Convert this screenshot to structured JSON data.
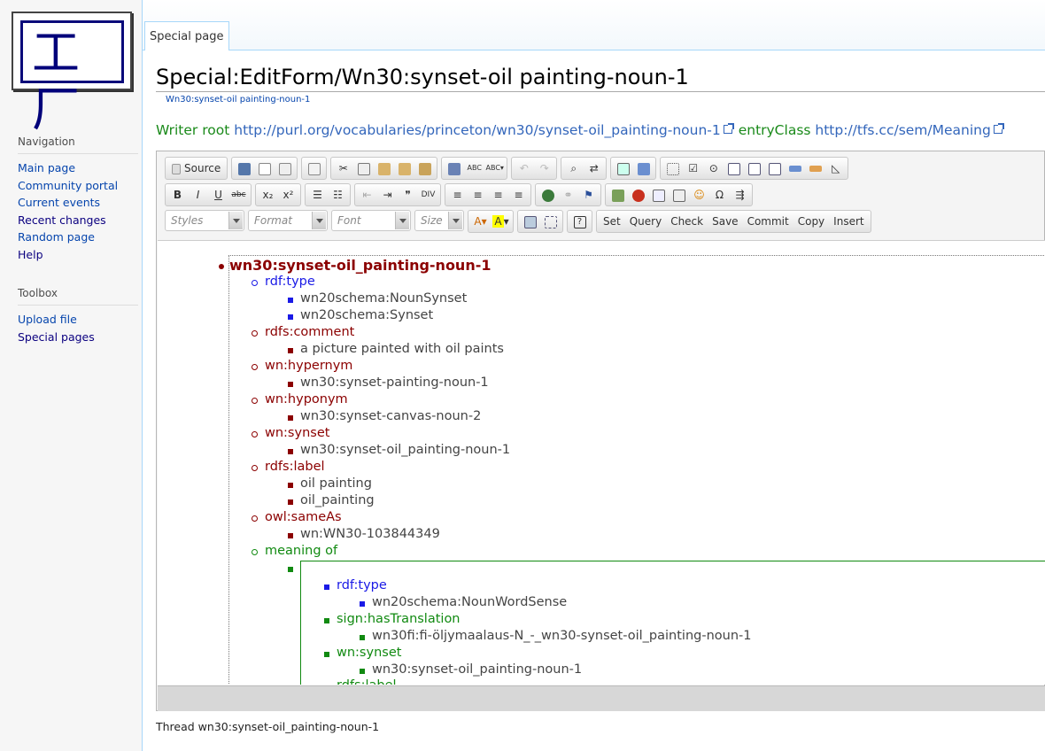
{
  "sidebar": {
    "nav_title": "Navigation",
    "nav_items": [
      "Main page",
      "Community portal",
      "Current events",
      "Recent changes",
      "Random page",
      "Help"
    ],
    "toolbox_title": "Toolbox",
    "toolbox_items": [
      "Upload file",
      "Special pages"
    ]
  },
  "tabs": {
    "special": "Special page"
  },
  "page": {
    "title": "Special:EditForm/Wn30:synset-oil painting-noun-1",
    "subtitle": "Wn30:synset-oil painting-noun-1",
    "writer_root_label": "Writer root",
    "writer_root_url": "http://purl.org/vocabularies/princeton/wn30/synset-oil_painting-noun-1",
    "entry_class_label": "entryClass",
    "entry_class_url": "http://tfs.cc/sem/Meaning",
    "thread": "Thread wn30:synset-oil_painting-noun-1"
  },
  "toolbar": {
    "source": "Source",
    "styles": "Styles",
    "format": "Format",
    "font": "Font",
    "size": "Size",
    "actions": [
      "Set",
      "Query",
      "Check",
      "Save",
      "Commit",
      "Copy",
      "Insert"
    ]
  },
  "tree": {
    "root": "wn30:synset-oil_painting-noun-1",
    "props": [
      {
        "name": "rdf:type",
        "values": [
          "wn20schema:NounSynset",
          "wn20schema:Synset"
        ]
      },
      {
        "name": "rdfs:comment",
        "values": [
          "a picture painted with oil paints"
        ]
      },
      {
        "name": "wn:hypernym",
        "values": [
          "wn30:synset-painting-noun-1"
        ]
      },
      {
        "name": "wn:hyponym",
        "values": [
          "wn30:synset-canvas-noun-2"
        ]
      },
      {
        "name": "wn:synset",
        "values": [
          "wn30:synset-oil_painting-noun-1"
        ]
      },
      {
        "name": "rdfs:label",
        "values": [
          "oil painting",
          "oil_painting"
        ]
      },
      {
        "name": "owl:sameAs",
        "values": [
          "wn:WN30-103844349"
        ]
      }
    ],
    "meaning_of": "meaning of",
    "nested": [
      {
        "name": "rdf:type",
        "value": "wn20schema:NounWordSense"
      },
      {
        "name": "sign:hasTranslation",
        "value": "wn30fi:fi-öljymaalaus-N_-_wn30-synset-oil_painting-noun-1"
      },
      {
        "name": "wn:synset",
        "value": "wn30:synset-oil_painting-noun-1"
      }
    ],
    "cut_label": "rdfs:label"
  },
  "colors": {
    "link": "#0645ad",
    "dark_red": "#8b0000",
    "blue": "#1a1ae6",
    "green": "#118a11"
  }
}
